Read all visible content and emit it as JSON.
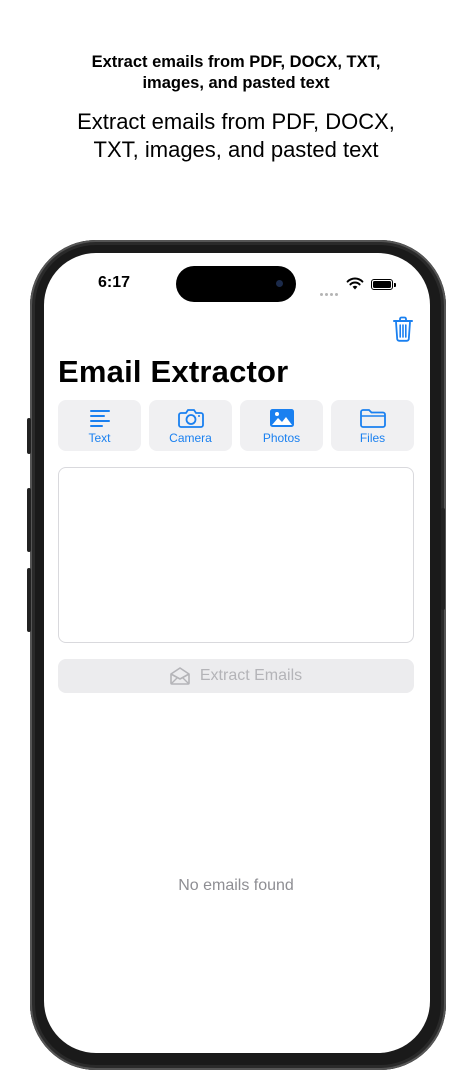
{
  "promo": {
    "bold_lines": [
      "Extract emails from PDF, DOCX, TXT,",
      "images, and pasted text"
    ],
    "regular_lines": [
      "Extract emails from PDF, DOCX,",
      "TXT, images, and pasted text"
    ]
  },
  "status_bar": {
    "time": "6:17"
  },
  "header": {
    "title": "Email Extractor",
    "trash_icon": "trash-icon"
  },
  "sources": [
    {
      "label": "Text",
      "icon": "text-lines-icon"
    },
    {
      "label": "Camera",
      "icon": "camera-icon"
    },
    {
      "label": "Photos",
      "icon": "photo-icon"
    },
    {
      "label": "Files",
      "icon": "folder-icon"
    }
  ],
  "input": {
    "value": ""
  },
  "extract_button": {
    "label": "Extract Emails",
    "icon": "envelope-open-icon"
  },
  "results": {
    "empty_text": "No emails found"
  },
  "colors": {
    "accent": "#1a80f0",
    "button_bg": "#f0f0f2",
    "disabled_text": "#b4b4b8",
    "secondary_text": "#8e8e93"
  }
}
